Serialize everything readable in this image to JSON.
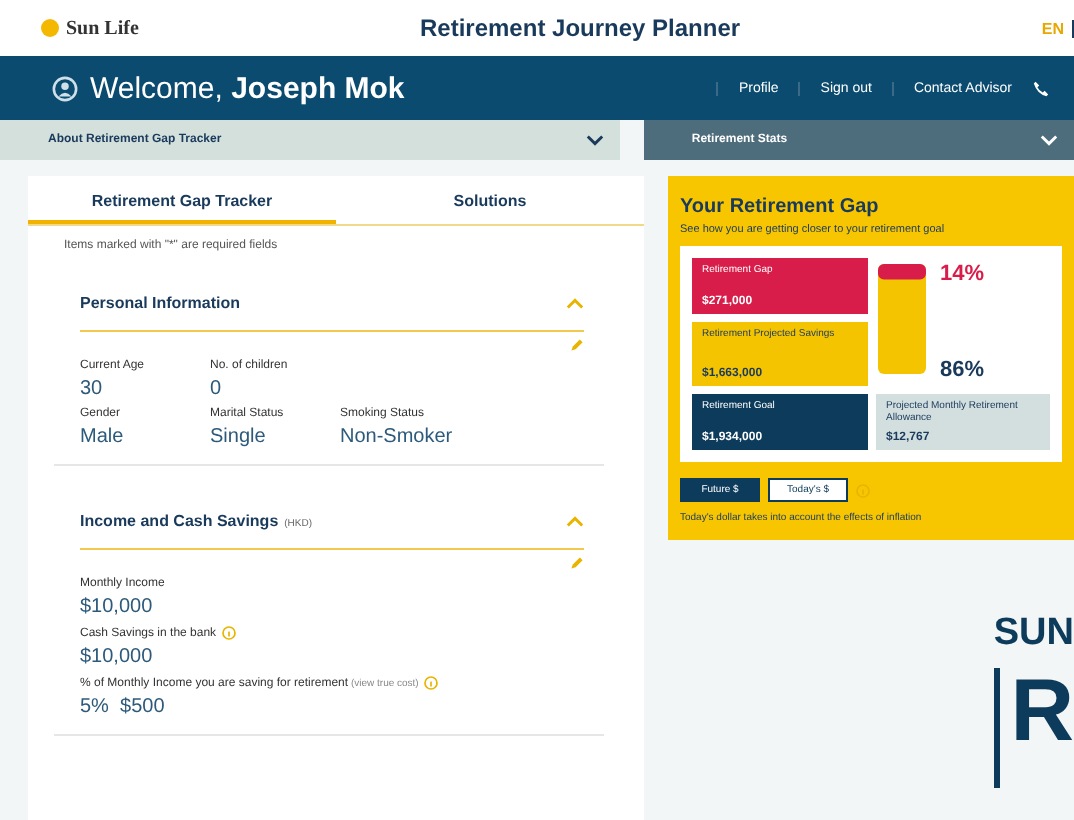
{
  "header": {
    "logo": "Sun Life",
    "title": "Retirement Journey Planner",
    "language": {
      "label": "EN",
      "selected": true
    }
  },
  "welcome_bar": {
    "greeting": "Welcome,",
    "name": "Joseph Mok",
    "links": [
      "Profile",
      "Sign out",
      "Contact Advisor"
    ]
  },
  "accordions": [
    {
      "label": "About Retirement Gap Tracker",
      "expanded": false
    },
    {
      "label": "Retirement Stats",
      "expanded": false
    }
  ],
  "tabs": [
    {
      "label": "Retirement Gap Tracker",
      "selected": true
    },
    {
      "label": "Solutions",
      "selected": false
    }
  ],
  "required_note": "Items marked with \"*\" are required fields",
  "sections": [
    {
      "title": "Personal Information",
      "expanded": true,
      "rows": [
        [
          {
            "label": "Current Age",
            "value": "30"
          },
          {
            "label": "No. of children",
            "value": "0"
          }
        ],
        [
          {
            "label": "Gender",
            "value": "Male"
          },
          {
            "label": "Marital Status",
            "value": "Single"
          },
          {
            "label": "Smoking Status",
            "value": "Non-Smoker"
          }
        ]
      ]
    },
    {
      "title": "Income and Cash Savings",
      "unit": "(HKD)",
      "expanded": true,
      "rows": [
        [
          {
            "label": "Monthly Income",
            "value": "$10,000"
          }
        ],
        [
          {
            "label": "Cash Savings in the bank",
            "value": "$10,000",
            "info": true
          }
        ],
        [
          {
            "label": "% of Monthly Income you are saving for retirement",
            "hint": "(view true cost)",
            "value": "5%  $500",
            "info": true
          }
        ]
      ]
    }
  ],
  "gap_card": {
    "title": "Your Retirement Gap",
    "subtitle": "See how you are getting closer to your retirement goal",
    "tiles": [
      {
        "label": "Retirement Gap",
        "value": "$271,000",
        "color": "#d91d4a"
      },
      {
        "label": "Retirement Projected Savings",
        "value": "$1,663,000",
        "color": "#f5c400"
      },
      {
        "label": "Retirement Goal",
        "value": "$1,934,000",
        "color": "#0d3b5c"
      }
    ],
    "gap_percent": "14%",
    "savings_percent": "86%",
    "level": 0.14,
    "allowance": {
      "label": "Projected Monthly Retirement Allowance",
      "value": "$12,767"
    },
    "toggle": [
      {
        "label": "Future $",
        "selected": true
      },
      {
        "label": "Today's $",
        "selected": false
      }
    ],
    "note": "Today's dollar takes into account the effects of inflation"
  },
  "brand": {
    "line_1": "SUN",
    "line_2": "R"
  }
}
